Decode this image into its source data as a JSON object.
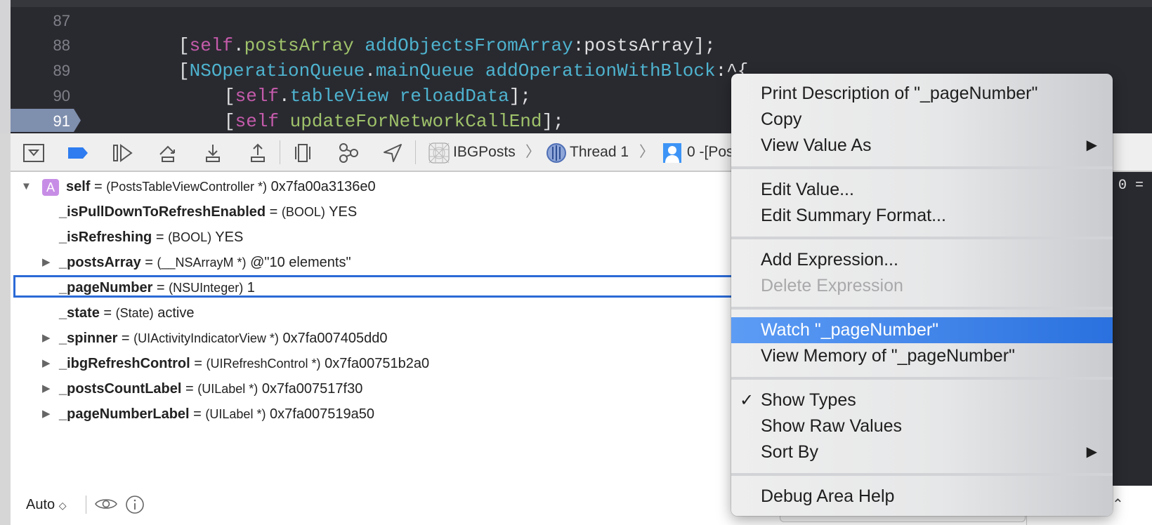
{
  "editor": {
    "lines": [
      {
        "number": "87",
        "tokens": []
      },
      {
        "number": "88",
        "tokens": [
          {
            "t": "[",
            "c": "plain"
          },
          {
            "t": "self",
            "c": "kw"
          },
          {
            "t": ".",
            "c": "plain"
          },
          {
            "t": "postsArray",
            "c": "prop"
          },
          {
            "t": " ",
            "c": "plain"
          },
          {
            "t": "addObjectsFromArray",
            "c": "meth"
          },
          {
            "t": ":postsArray];",
            "c": "plain"
          }
        ]
      },
      {
        "number": "89",
        "tokens": [
          {
            "t": "[",
            "c": "plain"
          },
          {
            "t": "NSOperationQueue",
            "c": "meth"
          },
          {
            "t": ".",
            "c": "plain"
          },
          {
            "t": "mainQueue",
            "c": "meth"
          },
          {
            "t": " ",
            "c": "plain"
          },
          {
            "t": "addOperationWithBlock",
            "c": "meth"
          },
          {
            "t": ":^{",
            "c": "plain"
          }
        ]
      },
      {
        "number": "90",
        "tokens": [
          {
            "t": "[",
            "c": "plain"
          },
          {
            "t": "self",
            "c": "kw"
          },
          {
            "t": ".",
            "c": "plain"
          },
          {
            "t": "tableView",
            "c": "meth"
          },
          {
            "t": " ",
            "c": "plain"
          },
          {
            "t": "reloadData",
            "c": "meth"
          },
          {
            "t": "];",
            "c": "plain"
          }
        ]
      },
      {
        "number": "91",
        "tokens": [
          {
            "t": "[",
            "c": "plain"
          },
          {
            "t": "self",
            "c": "kw"
          },
          {
            "t": " ",
            "c": "plain"
          },
          {
            "t": "updateForNetworkCallEnd",
            "c": "prop"
          },
          {
            "t": "];",
            "c": "plain"
          }
        ]
      }
    ],
    "current_line": "91"
  },
  "toolbar": {
    "breadcrumbs": [
      "IBGPosts",
      "Thread 1",
      "0 -[Pos"
    ]
  },
  "variables": [
    {
      "expand": true,
      "expanded": true,
      "badge": "A",
      "name": "self",
      "eq": " = ",
      "type": "(PostsTableViewController *)",
      "value": " 0x7fa00a3136e0"
    },
    {
      "expand": false,
      "name": "_isPullDownToRefreshEnabled",
      "eq": " = ",
      "type": "(BOOL)",
      "value": " YES"
    },
    {
      "expand": false,
      "name": "_isRefreshing",
      "eq": " = ",
      "type": "(BOOL)",
      "value": " YES"
    },
    {
      "expand": true,
      "name": "_postsArray",
      "eq": " = ",
      "type": "(__NSArrayM *)",
      "value": " @\"10 elements\""
    },
    {
      "expand": false,
      "name": "_pageNumber",
      "eq": " = ",
      "type": "(NSUInteger)",
      "value": " 1",
      "selected": true
    },
    {
      "expand": false,
      "name": "_state",
      "eq": " = ",
      "type": "(State)",
      "value": " active"
    },
    {
      "expand": true,
      "name": "_spinner",
      "eq": " = ",
      "type": "(UIActivityIndicatorView *)",
      "value": " 0x7fa007405dd0"
    },
    {
      "expand": true,
      "name": "_ibgRefreshControl",
      "eq": " = ",
      "type": "(UIRefreshControl *)",
      "value": " 0x7fa00751b2a0"
    },
    {
      "expand": true,
      "name": "_postsCountLabel",
      "eq": " = ",
      "type": "(UILabel *)",
      "value": " 0x7fa007517f30"
    },
    {
      "expand": true,
      "name": "_pageNumberLabel",
      "eq": " = ",
      "type": "(UILabel *)",
      "value": " 0x7fa007519a50"
    }
  ],
  "console": {
    "text": "0 ="
  },
  "bottom": {
    "mode": "Auto",
    "mode_chevron": "⌃⌄"
  },
  "context_menu": {
    "groups": [
      [
        {
          "label": "Print Description of \"_pageNumber\""
        },
        {
          "label": "Copy"
        },
        {
          "label": "View Value As",
          "submenu": true
        }
      ],
      [
        {
          "label": "Edit Value..."
        },
        {
          "label": "Edit Summary Format..."
        }
      ],
      [
        {
          "label": "Add Expression..."
        },
        {
          "label": "Delete Expression",
          "disabled": true
        }
      ],
      [
        {
          "label": "Watch \"_pageNumber\"",
          "highlighted": true
        },
        {
          "label": "View Memory of \"_pageNumber\""
        }
      ],
      [
        {
          "label": "Show Types",
          "checked": true
        },
        {
          "label": "Show Raw Values"
        },
        {
          "label": "Sort By",
          "submenu": true
        }
      ],
      [
        {
          "label": "Debug Area Help"
        }
      ]
    ]
  },
  "colors": {
    "accent": "#2b6ad6",
    "highlight": "#3a80e8",
    "editor_bg": "#292a30"
  }
}
